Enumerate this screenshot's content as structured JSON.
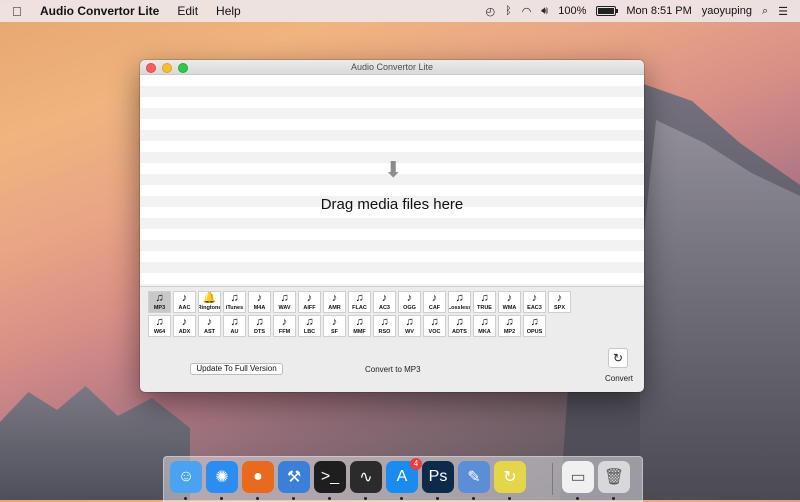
{
  "menubar": {
    "app_name": "Audio Convertor Lite",
    "menus": [
      "Edit",
      "Help"
    ],
    "battery_percent": 100,
    "battery_label": "100%",
    "clock": "Mon 8:51 PM",
    "user": "yaoyuping"
  },
  "window": {
    "title": "Audio Convertor Lite",
    "drop_text": "Drag media files here",
    "formats_row1": [
      {
        "label": "MP3",
        "glyph": "♫",
        "selected": true
      },
      {
        "label": "AAC",
        "glyph": "♪"
      },
      {
        "label": "Ringtone",
        "glyph": "🔔"
      },
      {
        "label": "iTunes",
        "glyph": "♫"
      },
      {
        "label": "M4A",
        "glyph": "♪"
      },
      {
        "label": "WAV",
        "glyph": "♫"
      },
      {
        "label": "AIFF",
        "glyph": "♪"
      },
      {
        "label": "AMR",
        "glyph": "♪"
      },
      {
        "label": "FLAC",
        "glyph": "♫"
      },
      {
        "label": "AC3",
        "glyph": "♪"
      },
      {
        "label": "OGG",
        "glyph": "♪"
      },
      {
        "label": "CAF",
        "glyph": "♪"
      },
      {
        "label": "Lossless",
        "glyph": "♫"
      },
      {
        "label": "TRUE",
        "glyph": "♫"
      },
      {
        "label": "WMA",
        "glyph": "♪"
      },
      {
        "label": "EAC3",
        "glyph": "♪"
      },
      {
        "label": "SPX",
        "glyph": "♪"
      }
    ],
    "formats_row2": [
      {
        "label": "W64",
        "glyph": "♫"
      },
      {
        "label": "ADX",
        "glyph": "♪"
      },
      {
        "label": "AST",
        "glyph": "♪"
      },
      {
        "label": "AU",
        "glyph": "♫"
      },
      {
        "label": "DTS",
        "glyph": "♫"
      },
      {
        "label": "FFM",
        "glyph": "♪"
      },
      {
        "label": "LBC",
        "glyph": "♫"
      },
      {
        "label": "SF",
        "glyph": "♪"
      },
      {
        "label": "MMF",
        "glyph": "♫"
      },
      {
        "label": "RSO",
        "glyph": "♫"
      },
      {
        "label": "WV",
        "glyph": "♫"
      },
      {
        "label": "VOC",
        "glyph": "♫"
      },
      {
        "label": "ADTS",
        "glyph": "♫"
      },
      {
        "label": "MKA",
        "glyph": "♫"
      },
      {
        "label": "MP2",
        "glyph": "♫"
      },
      {
        "label": "OPUS",
        "glyph": "♫"
      }
    ],
    "update_button": "Update To Full Version",
    "status": "Convert to MP3",
    "convert_label": "Convert"
  },
  "dock": {
    "items": [
      {
        "name": "finder",
        "icon": "finder-icon",
        "glyph": "☺",
        "color": "#4aa3f0"
      },
      {
        "name": "safari",
        "icon": "compass-icon",
        "glyph": "✺",
        "color": "#2d8cf0"
      },
      {
        "name": "firefox",
        "icon": "firefox-icon",
        "glyph": "●",
        "color": "#e86a1f"
      },
      {
        "name": "xcode",
        "icon": "hammer-icon",
        "glyph": "⚒",
        "color": "#3c7fd8"
      },
      {
        "name": "terminal",
        "icon": "terminal-icon",
        "glyph": ">_",
        "color": "#1e1e1e"
      },
      {
        "name": "activity-monitor",
        "icon": "monitor-icon",
        "glyph": "∿",
        "color": "#2b2b2b"
      },
      {
        "name": "app-store",
        "icon": "appstore-icon",
        "glyph": "A",
        "color": "#1a8cf0",
        "badge": "4"
      },
      {
        "name": "photoshop",
        "icon": "photoshop-icon",
        "glyph": "Ps",
        "color": "#0d2a4a"
      },
      {
        "name": "preview",
        "icon": "preview-icon",
        "glyph": "✎",
        "color": "#5b8ed6"
      },
      {
        "name": "audio-convertor",
        "icon": "convert-icon",
        "glyph": "↻",
        "color": "#e4d54a"
      },
      {
        "name": "firefox-window",
        "icon": "window-icon",
        "glyph": "▭",
        "color": "#f0f0f0"
      },
      {
        "name": "trash",
        "icon": "trash-icon",
        "glyph": "🗑",
        "color": "#d8d8dc"
      }
    ]
  }
}
